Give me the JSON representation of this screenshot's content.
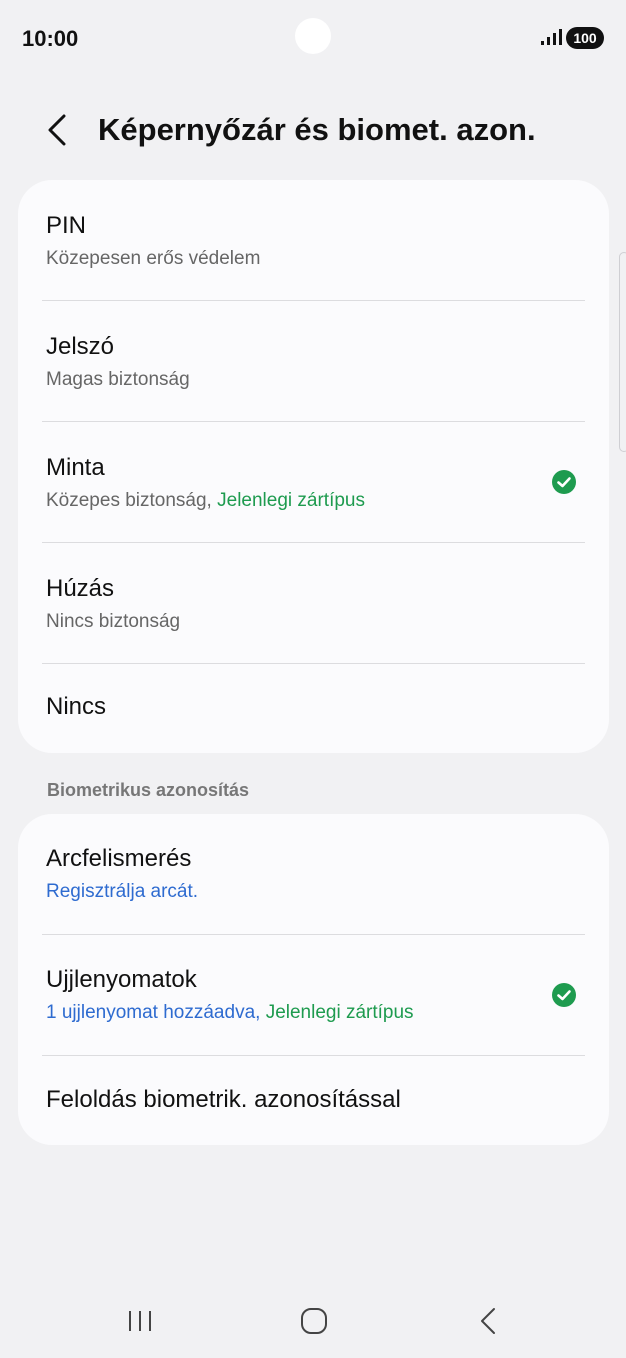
{
  "status_bar": {
    "time": "10:00",
    "battery": "100"
  },
  "header": {
    "title": "Képernyőzár és biomet. azon."
  },
  "lock_options": [
    {
      "title": "PIN",
      "subtitle": "Közepesen erős védelem"
    },
    {
      "title": "Jelszó",
      "subtitle": "Magas biztonság"
    },
    {
      "title": "Minta",
      "subtitle": "Közepes biztonság, ",
      "subtitle_highlight": "Jelenlegi zártípus",
      "selected": true
    },
    {
      "title": "Húzás",
      "subtitle": "Nincs biztonság"
    },
    {
      "title": "Nincs"
    }
  ],
  "biometrics": {
    "section_title": "Biometrikus azonosítás",
    "items": [
      {
        "title": "Arcfelismerés",
        "subtitle": "Regisztrálja arcát."
      },
      {
        "title": "Ujjlenyomatok",
        "subtitle": "1 ujjlenyomat hozzáadva, ",
        "subtitle_highlight": "Jelenlegi zártípus",
        "selected": true
      },
      {
        "title": "Feloldás biometrik. azonosítással"
      }
    ]
  },
  "icons": {
    "back": "chevron-left-icon",
    "check": "check-circle-icon",
    "signal": "signal-icon",
    "recents": "recents-icon",
    "home": "home-icon",
    "nav_back": "back-icon"
  },
  "colors": {
    "accent_green": "#1e9b4f",
    "link_blue": "#2e6bd0",
    "background": "#f1f1f3",
    "card": "#fbfbfd"
  }
}
